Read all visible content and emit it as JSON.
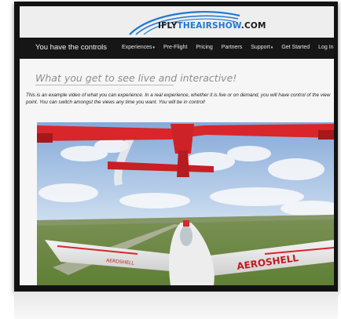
{
  "logo": {
    "prefix": "IFLY",
    "highlight": "THEAIRSHOW",
    "suffix": ".COM"
  },
  "nav": {
    "brand": "You have the controls",
    "items": [
      {
        "label": "Experiences",
        "caret": "▾"
      },
      {
        "label": "Pre-Flight",
        "caret": ""
      },
      {
        "label": "Pricing",
        "caret": ""
      },
      {
        "label": "Partners",
        "caret": ""
      },
      {
        "label": "Support",
        "caret": "▾"
      },
      {
        "label": "Get Started",
        "caret": ""
      },
      {
        "label": "Log In",
        "caret": ""
      }
    ]
  },
  "main": {
    "heading": "What you get to see live and interactive!",
    "paragraph": "This is an example video of what you can experience. In a real experience, whether it is live or on demand, you will have control of the view point. You can switch amongst the views any time you want. You will be in control!"
  },
  "video": {
    "aircraft_lettering_left": "AEROSHELL",
    "aircraft_lettering_right": "AEROSHELL",
    "colors": {
      "sky_top": "#86a9d9",
      "sky_horizon": "#d7e6f3",
      "ground": "#6c8a3f",
      "plane_red": "#d8262a"
    }
  },
  "colors": {
    "navbar": "#161616",
    "accent_blue": "#1f78d1"
  }
}
